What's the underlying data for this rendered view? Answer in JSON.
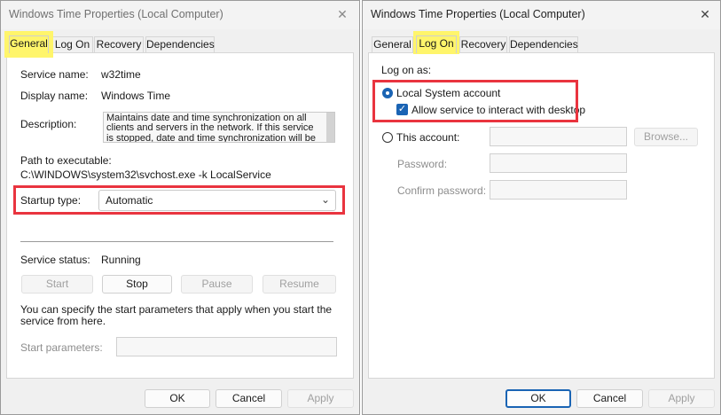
{
  "left_dialog": {
    "title": "Windows Time Properties (Local Computer)",
    "close_glyph": "✕",
    "tabs": [
      "General",
      "Log On",
      "Recovery",
      "Dependencies"
    ],
    "active_tab": "General",
    "service_name_label": "Service name:",
    "service_name_value": "w32time",
    "display_name_label": "Display name:",
    "display_name_value": "Windows Time",
    "description_label": "Description:",
    "description_value": "Maintains date and time synchronization on all clients and servers in the network. If this service is stopped, date and time synchronization will be",
    "path_label": "Path to executable:",
    "path_value": "C:\\WINDOWS\\system32\\svchost.exe -k LocalService",
    "startup_type_label": "Startup type:",
    "startup_type_value": "Automatic",
    "service_status_label": "Service status:",
    "service_status_value": "Running",
    "buttons": {
      "start": "Start",
      "stop": "Stop",
      "pause": "Pause",
      "resume": "Resume"
    },
    "start_params_note": "You can specify the start parameters that apply when you start the service from here.",
    "start_params_label": "Start parameters:",
    "start_params_value": "",
    "footer": {
      "ok": "OK",
      "cancel": "Cancel",
      "apply": "Apply"
    }
  },
  "right_dialog": {
    "title": "Windows Time Properties (Local Computer)",
    "close_glyph": "✕",
    "tabs": [
      "General",
      "Log On",
      "Recovery",
      "Dependencies"
    ],
    "active_tab": "Log On",
    "log_on_as_label": "Log on as:",
    "local_system_label": "Local System account",
    "local_system_selected": true,
    "interact_desktop_label": "Allow service to interact with desktop",
    "interact_desktop_checked": true,
    "this_account_label": "This account:",
    "this_account_value": "",
    "browse_button": "Browse...",
    "password_label": "Password:",
    "password_value": "",
    "confirm_password_label": "Confirm password:",
    "confirm_password_value": "",
    "footer": {
      "ok": "OK",
      "cancel": "Cancel",
      "apply": "Apply"
    }
  },
  "colors": {
    "highlight_yellow": "#fff56b",
    "annotation_red": "#e9343f",
    "accent_blue": "#1a64b4",
    "dialog_bg": "#f0f0f0"
  },
  "icons": {
    "close": "close-icon",
    "dropdown": "chevron-down-icon",
    "check": "checkmark-icon"
  }
}
